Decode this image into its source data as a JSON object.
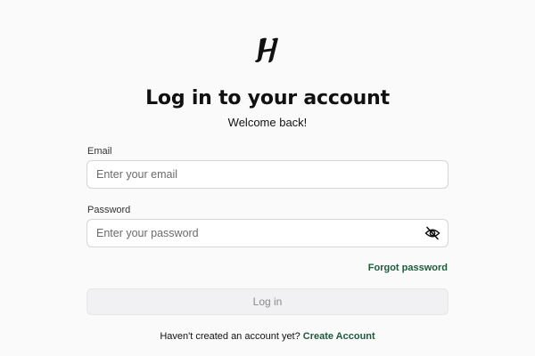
{
  "brand": {
    "logo_letter": "H",
    "logo_icon": "h-script-logo-icon"
  },
  "header": {
    "title": "Log in to your account",
    "subtitle": "Welcome back!"
  },
  "form": {
    "email": {
      "label": "Email",
      "placeholder": "Enter your email",
      "value": ""
    },
    "password": {
      "label": "Password",
      "placeholder": "Enter your password",
      "value": "",
      "toggle_icon": "eye-slash-icon"
    },
    "forgot_password": "Forgot password",
    "submit_label": "Log in",
    "submit_state": "disabled"
  },
  "footer": {
    "prompt": "Haven't created an account yet?",
    "link": "Create Account"
  },
  "colors": {
    "background": "#fafafa",
    "text": "#111111",
    "accent_link": "#1f5a3d",
    "input_border": "#d6d6d6",
    "button_bg_disabled": "#f1f1f3",
    "button_text_disabled": "#8a8a8a"
  }
}
